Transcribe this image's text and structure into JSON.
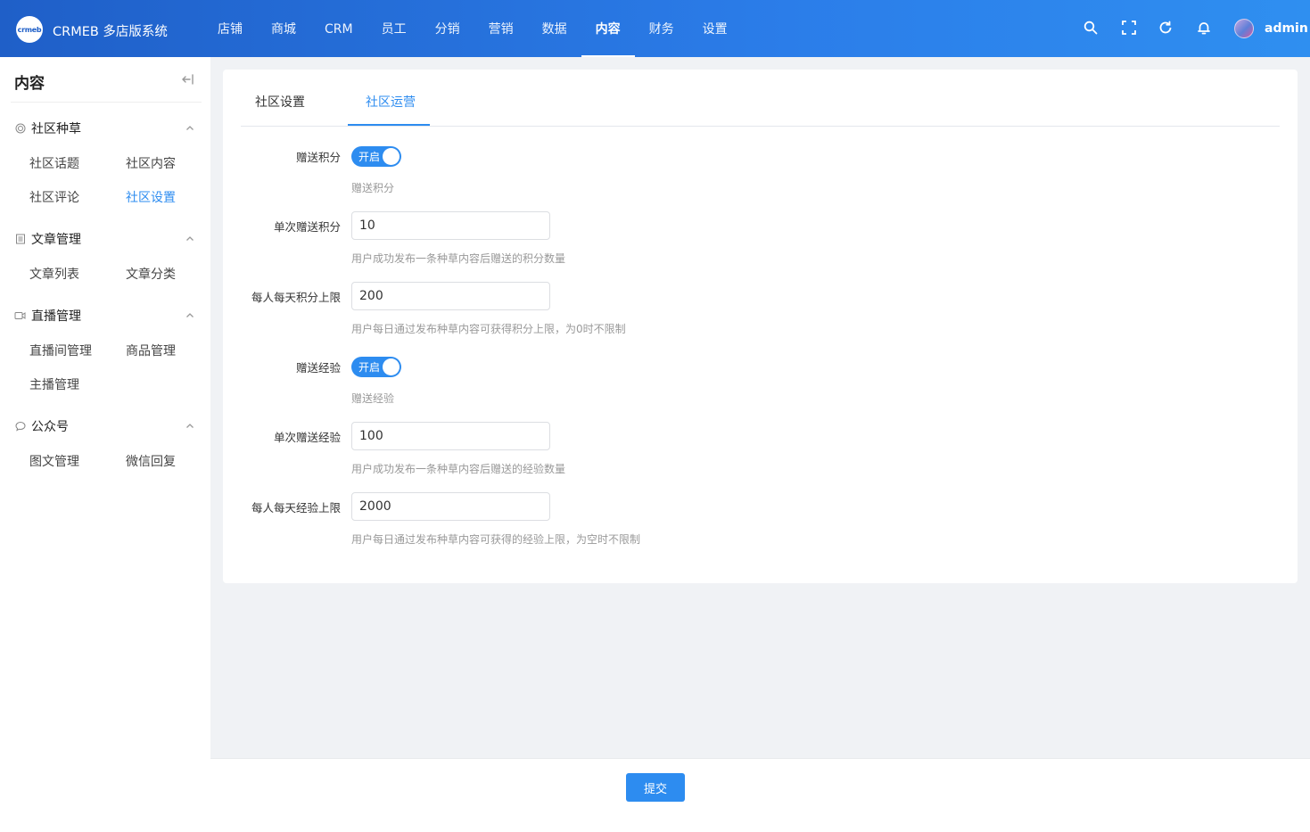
{
  "header": {
    "logo_text": "crmeb",
    "brand": "CRMEB 多店版系统",
    "nav": [
      "店铺",
      "商城",
      "CRM",
      "员工",
      "分销",
      "营销",
      "数据",
      "内容",
      "财务",
      "设置"
    ],
    "active_nav": "内容",
    "icons": [
      "search-icon",
      "fullscreen-icon",
      "refresh-icon",
      "bell-icon"
    ],
    "username": "admin",
    "colors": {
      "gradient_start": "#1f5fc8",
      "gradient_end": "#2f8ff0"
    }
  },
  "sidebar": {
    "title": "内容",
    "groups": [
      {
        "label": "社区种草",
        "icon": "target-icon",
        "items": [
          "社区话题",
          "社区内容",
          "社区评论",
          "社区设置"
        ]
      },
      {
        "label": "文章管理",
        "icon": "document-icon",
        "items": [
          "文章列表",
          "文章分类"
        ]
      },
      {
        "label": "直播管理",
        "icon": "video-icon",
        "items": [
          "直播间管理",
          "商品管理",
          "主播管理"
        ]
      },
      {
        "label": "公众号",
        "icon": "chat-icon",
        "items": [
          "图文管理",
          "微信回复"
        ]
      }
    ],
    "active_item": "社区设置"
  },
  "tabs": [
    "社区设置",
    "社区运营"
  ],
  "active_tab": "社区运营",
  "form": {
    "give_points": {
      "label": "赠送积分",
      "switch_text": "开启",
      "enabled": true,
      "hint": "赠送积分"
    },
    "points_per_post": {
      "label": "单次赠送积分",
      "value": "10",
      "hint": "用户成功发布一条种草内容后赠送的积分数量"
    },
    "points_daily_limit": {
      "label": "每人每天积分上限",
      "value": "200",
      "hint": "用户每日通过发布种草内容可获得积分上限，为0时不限制"
    },
    "give_exp": {
      "label": "赠送经验",
      "switch_text": "开启",
      "enabled": true,
      "hint": "赠送经验"
    },
    "exp_per_post": {
      "label": "单次赠送经验",
      "value": "100",
      "hint": "用户成功发布一条种草内容后赠送的经验数量"
    },
    "exp_daily_limit": {
      "label": "每人每天经验上限",
      "value": "2000",
      "hint": "用户每日通过发布种草内容可获得的经验上限，为空时不限制"
    }
  },
  "footer": {
    "submit_label": "提交"
  },
  "accent_color": "#2d8cf0"
}
